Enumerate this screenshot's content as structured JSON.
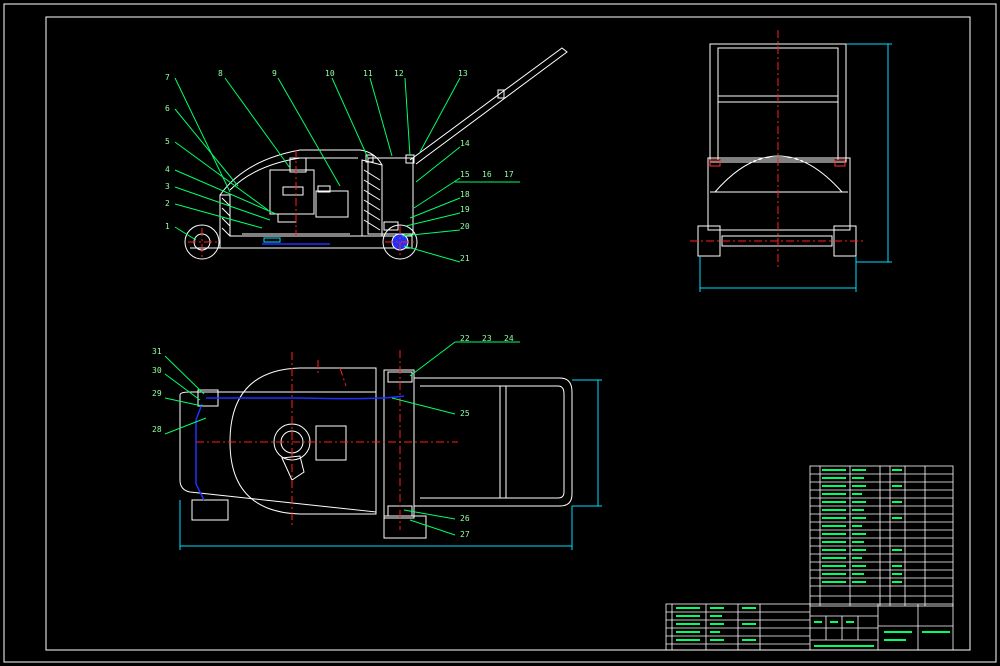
{
  "drawing": {
    "view_side": {
      "part_numbers": [
        "1",
        "2",
        "3",
        "4",
        "5",
        "6",
        "7",
        "8",
        "9",
        "10",
        "11",
        "12",
        "13",
        "14",
        "15",
        "16",
        "17",
        "18",
        "19",
        "20",
        "21"
      ]
    },
    "view_top": {
      "part_numbers": [
        "22",
        "23",
        "24",
        "25",
        "26",
        "27",
        "28",
        "29",
        "30",
        "31"
      ]
    },
    "colors": {
      "background": "#000000",
      "outline": "#ffffff",
      "leader": "#00ff66",
      "centerline": "#ff2020",
      "belt": "#2030ff",
      "dimension": "#00e0ff",
      "frame": "#ffffff"
    }
  }
}
